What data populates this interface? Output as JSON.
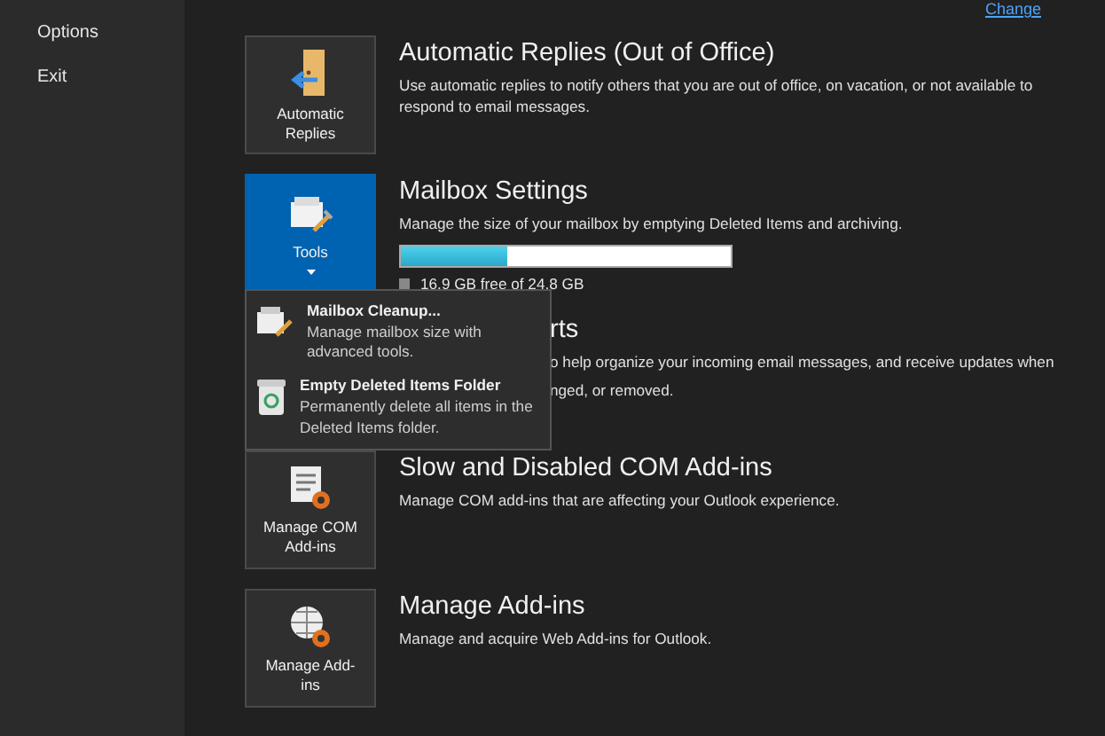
{
  "sidebar": {
    "items": [
      {
        "label": "Options"
      },
      {
        "label": "Exit"
      }
    ]
  },
  "header_link": "Change",
  "sections": [
    {
      "kind": "normal",
      "tile": {
        "kind": "replies",
        "label": "Automatic Replies",
        "expanded": false
      },
      "title": "Automatic Replies (Out of Office)",
      "description": "Use automatic replies to notify others that you are out of office, on vacation, or not available to respond to email messages."
    },
    {
      "kind": "storage",
      "tile": {
        "kind": "tools",
        "label": "Tools",
        "expanded": true
      },
      "title": "Mailbox Settings",
      "description": "Manage the size of your mailbox by emptying Deleted Items and archiving.",
      "storage": {
        "level": 0.32,
        "reading": "16.9 GB free of 24.8 GB"
      }
    },
    {
      "kind": "obscured",
      "title": "rts",
      "description_lines": [
        "o help organize your incoming email messages, and receive updates when",
        "nged, or removed."
      ]
    },
    {
      "kind": "normal",
      "tile": {
        "kind": "com",
        "label": "Manage COM Add-ins",
        "expanded": false
      },
      "title": "Slow and Disabled COM Add-ins",
      "description": "Manage COM add-ins that are affecting your Outlook experience."
    },
    {
      "kind": "normal",
      "tile": {
        "kind": "addins",
        "label": "Manage Add-ins",
        "expanded": false
      },
      "title": "Manage Add-ins",
      "description": "Manage and acquire Web Add-ins for Outlook."
    }
  ],
  "dropdown": {
    "items": [
      {
        "kind": "cleanup",
        "title": "Mailbox Cleanup...",
        "description": "Manage mailbox size with advanced tools."
      },
      {
        "kind": "trash",
        "title": "Empty Deleted Items Folder",
        "description": "Permanently delete all items in the Deleted Items folder."
      }
    ]
  }
}
